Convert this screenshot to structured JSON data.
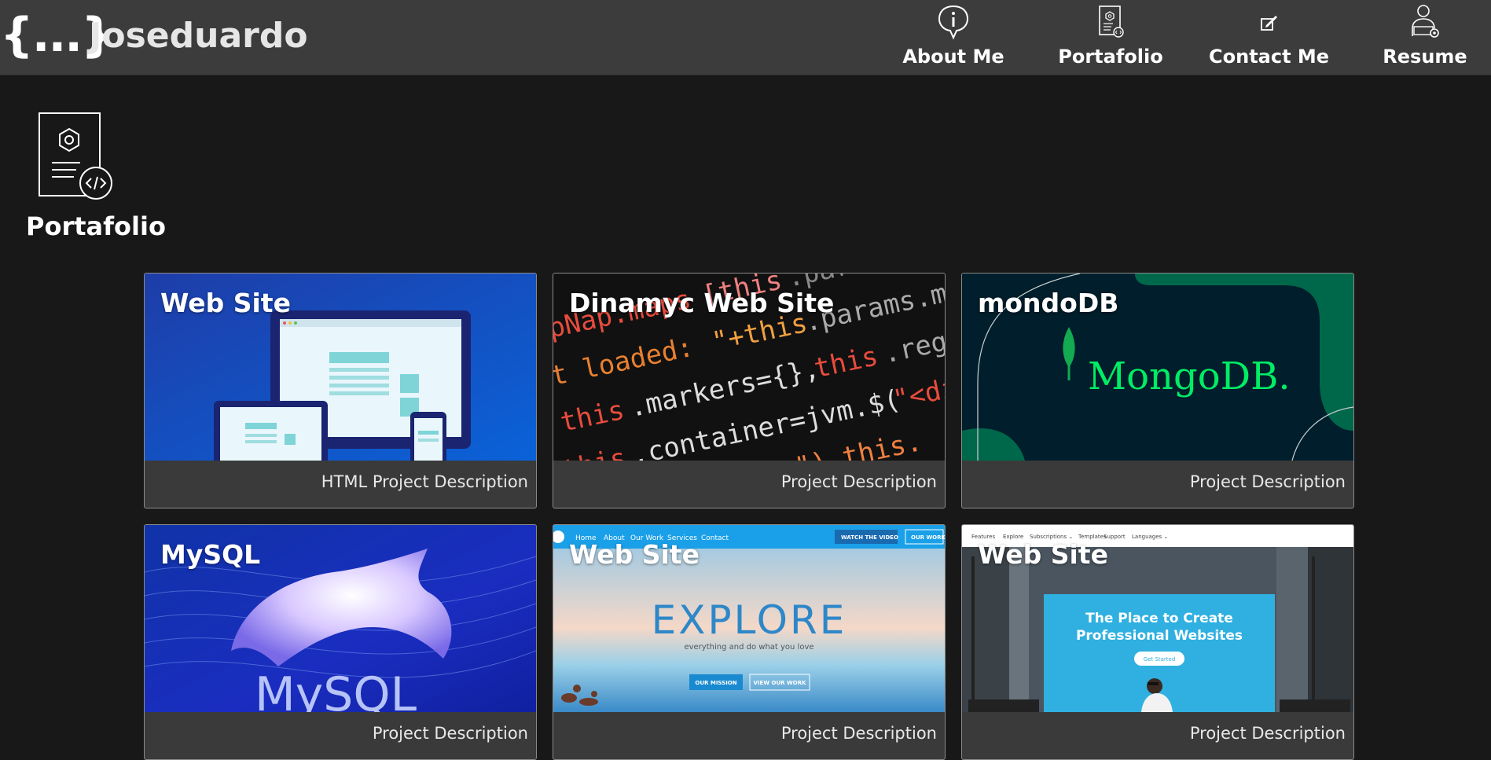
{
  "header": {
    "brand_mark": "{...}",
    "brand_name": "Joseduardo",
    "nav": [
      {
        "label": "About Me",
        "icon": "info-bubble-icon"
      },
      {
        "label": "Portafolio",
        "icon": "portfolio-document-icon"
      },
      {
        "label": "Contact Me",
        "icon": "edit-note-icon"
      },
      {
        "label": "Resume",
        "icon": "person-gear-icon"
      }
    ]
  },
  "section": {
    "title": "Portafolio",
    "icon": "portfolio-document-icon"
  },
  "cards": [
    {
      "title": "Web Site",
      "description": "HTML Project Description",
      "thumbnail": "responsive-devices-image"
    },
    {
      "title": "Dinamyc Web Site",
      "description": "Project Description",
      "thumbnail": "code-screen-image"
    },
    {
      "title": "mondoDB",
      "description": "Project Description",
      "thumbnail": "mongodb-logo-image",
      "thumb_text": "MongoDB."
    },
    {
      "title": "MySQL",
      "description": "Project Description",
      "thumbnail": "mysql-dolphin-image",
      "thumb_text": "MySQL"
    },
    {
      "title": "Web Site",
      "description": "Project Description",
      "thumbnail": "explore-landing-page-image",
      "thumb_nav": [
        "Home",
        "About",
        "Our Work",
        "Services",
        "Contact"
      ],
      "thumb_btn_video": "WATCH THE VIDEO",
      "thumb_btn_work": "OUR WORK",
      "thumb_headline": "EXPLORE",
      "thumb_tagline": "everything and do what you love",
      "thumb_btn_mission": "OUR MISSION",
      "thumb_btn_view": "VIEW OUR WORK"
    },
    {
      "title": "Web Site",
      "description": "Project Description",
      "thumbnail": "professional-websites-image",
      "thumb_nav": [
        "Features",
        "Explore",
        "Subscriptions ⌄",
        "Templates",
        "Support",
        "Languages ⌄"
      ],
      "thumb_headline_1": "The Place to Create",
      "thumb_headline_2": "Professional Websites",
      "thumb_btn": "Get Started"
    }
  ],
  "colors": {
    "background": "#181818",
    "header_bg": "#3c3c3c",
    "card_bg": "#3a3a3a",
    "mongodb_green": "#13aa52"
  }
}
